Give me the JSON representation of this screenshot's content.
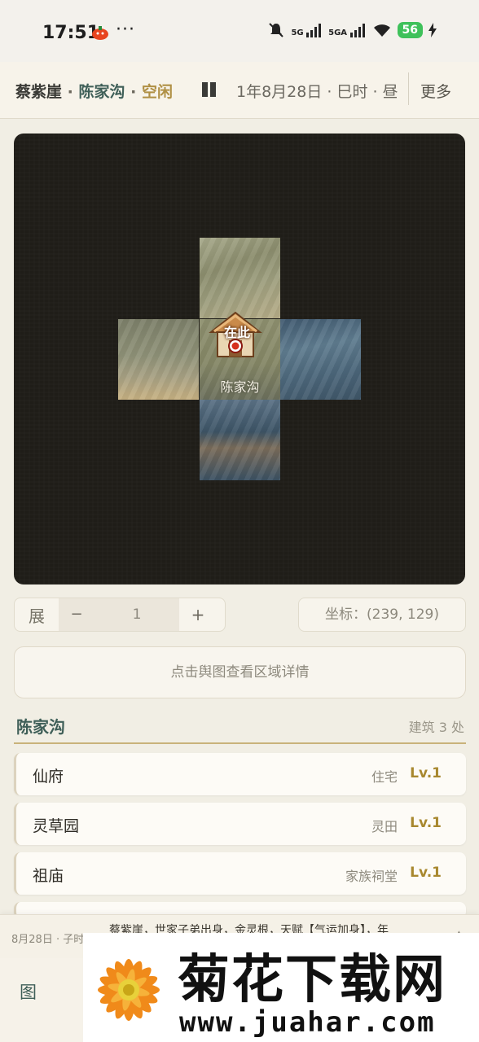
{
  "status_bar": {
    "time": "17:51",
    "dots": "···",
    "net1": "5G",
    "net2": "5GA",
    "battery": "56"
  },
  "header": {
    "player": "蔡紫崖",
    "sep": "·",
    "location": "陈家沟",
    "status": "空闲",
    "date": "1年8月28日 · 巳时 · 昼",
    "more": "更多"
  },
  "map": {
    "here_label": "在此",
    "place_name": "陈家沟"
  },
  "controls": {
    "zoom_label": "展",
    "minus": "−",
    "zoom_value": "1",
    "plus": "+",
    "coords": "坐标：(239, 129)"
  },
  "detail_button": "点击舆图查看区域详情",
  "section": {
    "title": "陈家沟",
    "count": "建筑 3 处"
  },
  "buildings": [
    {
      "name": "仙府",
      "type": "住宅",
      "level": "Lv.1"
    },
    {
      "name": "灵草园",
      "type": "灵田",
      "level": "Lv.1"
    },
    {
      "name": "祖庙",
      "type": "家族祠堂",
      "level": "Lv.1"
    }
  ],
  "log": {
    "time": "8月28日 · 子时",
    "text": "蔡紫崖，世家子弟出身，金灵根，天赋【气运加身】，年",
    "arrow": "▲"
  },
  "nav": {
    "item_map": "图"
  },
  "watermark": {
    "title": "菊花下载网",
    "url": "www.juahar.com"
  }
}
